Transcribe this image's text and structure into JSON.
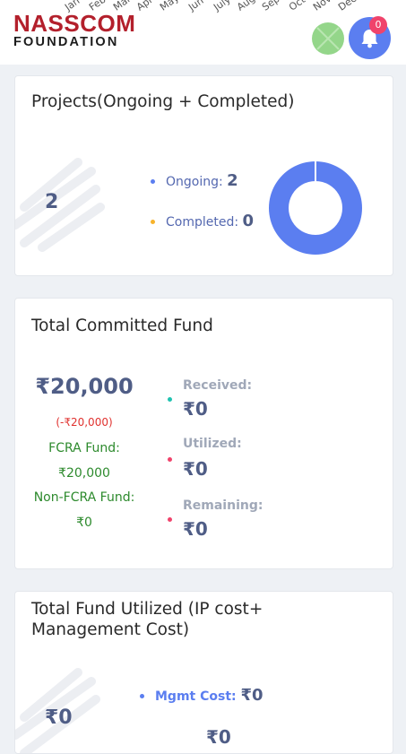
{
  "header": {
    "logo_top": "NASSCOM",
    "logo_bottom": "FOUNDATION",
    "months": [
      "Jan",
      "Feb",
      "Mar",
      "Apr",
      "May",
      "Jun",
      "July",
      "Aug",
      "Sep",
      "Oct",
      "Nov",
      "Dec"
    ],
    "notification_count": "0"
  },
  "projects_card": {
    "title": "Projects(Ongoing + Completed)",
    "total": "2",
    "ongoing_label": "Ongoing:",
    "ongoing_value": "2",
    "completed_label": "Completed:",
    "completed_value": "0",
    "colors": {
      "ongoing": "#5b7ef0",
      "completed": "#f7b32b"
    }
  },
  "chart_data": {
    "type": "pie",
    "categories": [
      "Ongoing",
      "Completed"
    ],
    "values": [
      2,
      0
    ]
  },
  "committed_card": {
    "title": "Total Committed Fund",
    "amount": "₹20,000",
    "delta": "(-₹20,000)",
    "fcra_label": "FCRA Fund:",
    "fcra_value": "₹20,000",
    "nonfcra_label": "Non-FCRA Fund:",
    "nonfcra_value": "₹0",
    "received_label": "Received:",
    "received_value": "₹0",
    "utilized_label": "Utilized:",
    "utilized_value": "₹0",
    "remaining_label": "Remaining:",
    "remaining_value": "₹0",
    "colors": {
      "received": "#1fc2b0",
      "utilized": "#f0436b",
      "remaining": "#f0436b"
    }
  },
  "utilized_card": {
    "title_line1": "Total Fund Utilized (IP cost+",
    "title_line2": "Management Cost)",
    "total": "₹0",
    "mgmt_label": "Mgmt Cost:",
    "mgmt_value": "₹0",
    "ip_value": "₹0"
  }
}
